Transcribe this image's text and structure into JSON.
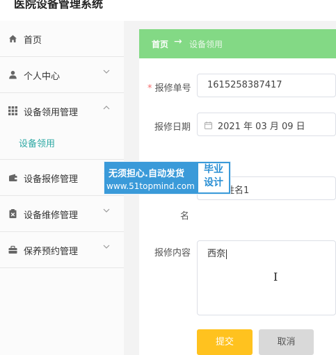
{
  "app": {
    "title": "医院设备管理系统"
  },
  "sidebar": {
    "items": [
      {
        "label": "首页",
        "icon": "home-icon"
      },
      {
        "label": "个人中心",
        "icon": "user-icon",
        "chevron": "down"
      },
      {
        "label": "设备领用管理",
        "icon": "grid-icon",
        "chevron": "up",
        "expanded": true
      },
      {
        "label": "设备报修管理",
        "icon": "wallet-icon",
        "chevron": "down"
      },
      {
        "label": "设备维修管理",
        "icon": "clipboard-icon",
        "chevron": "down"
      },
      {
        "label": "保养预约管理",
        "icon": "briefcase-icon",
        "chevron": "down"
      }
    ],
    "submenu": {
      "label": "设备领用",
      "color": "#2ea9a4"
    }
  },
  "breadcrumb": {
    "home": "首页",
    "arrow": "→",
    "current": "设备领用",
    "background": "#83d985"
  },
  "form": {
    "order_no": {
      "label": "报修单号",
      "required_mark": "*",
      "value": "1615258387417"
    },
    "date": {
      "label": "报修日期",
      "value": "2021 年 03 月 09 日"
    },
    "name": {
      "label_tail": "名",
      "value_tail": "姓名1"
    },
    "content": {
      "label": "报修内容",
      "value": "西奈"
    }
  },
  "buttons": {
    "submit": {
      "label": "提交",
      "color": "#ffc21f"
    },
    "cancel": {
      "label": "取消"
    }
  },
  "watermark": {
    "line1": "无须担心.自动发货",
    "line2": "www.51topmind.com",
    "box_line1": "毕业",
    "box_line2": "设计",
    "color": "#3a9ad9"
  }
}
